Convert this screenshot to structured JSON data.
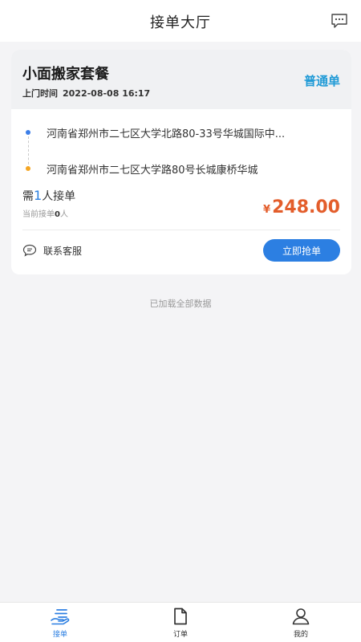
{
  "header": {
    "title": "接单大厅",
    "message_icon": "chat-bubble-icon"
  },
  "order": {
    "title": "小面搬家套餐",
    "visit_label": "上门时间",
    "visit_time": "2022-08-08 16:17",
    "type_label": "普通单",
    "start_address": "河南省郑州市二七区大学北路80-33号华城国际中...",
    "end_address": "河南省郑州市二七区大学路80号长城康桥华城",
    "need_prefix": "需",
    "need_count": "1",
    "need_suffix": "人接单",
    "current_prefix": "当前接单",
    "current_count": "0",
    "current_suffix": "人",
    "price_symbol": "¥",
    "price": "248.00",
    "service_label": "联系客服",
    "grab_button": "立即抢单"
  },
  "list_status": "已加载全部数据",
  "tabbar": {
    "items": [
      {
        "label": "接单",
        "icon": "hand-list-icon",
        "active": true
      },
      {
        "label": "订单",
        "icon": "document-icon",
        "active": false
      },
      {
        "label": "我的",
        "icon": "user-icon",
        "active": false
      }
    ]
  },
  "colors": {
    "accent": "#2c7fe2",
    "price": "#e35d2b",
    "order_type": "#1f9ad6",
    "start_dot": "#3c7ee8",
    "end_dot": "#f5a623"
  }
}
